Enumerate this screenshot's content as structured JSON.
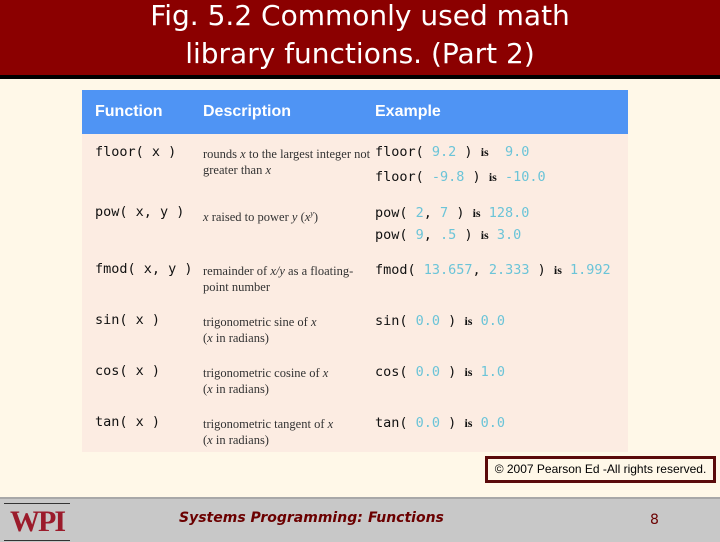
{
  "title": {
    "line1": "Fig. 5.2 Commonly used math",
    "line2": "library functions. (Part 2)"
  },
  "table": {
    "headers": [
      "Function",
      "Description",
      "Example"
    ],
    "rows": [
      {
        "function": "floor( x )",
        "description_parts": [
          "rounds ",
          "x",
          " to the largest  integer not greater than ",
          "x"
        ],
        "examples": [
          {
            "call": "floor(",
            "args": [
              " 9.2"
            ],
            "close": " )",
            "is": "is",
            "result": "  9.0"
          },
          {
            "call": "floor(",
            "args": [
              " -9.8"
            ],
            "close": " )",
            "is": "is",
            "result": " -10.0"
          }
        ]
      },
      {
        "function": "pow( x, y )",
        "description_parts": [
          "x",
          " raised to power ",
          "y",
          " (",
          "x",
          "y",
          ")"
        ],
        "examples": [
          {
            "call": "pow(",
            "args": [
              " 2",
              ", ",
              "7"
            ],
            "close": " )",
            "is": "is",
            "result": " 128.0"
          },
          {
            "call": "pow(",
            "args": [
              " 9",
              ", ",
              ".5"
            ],
            "close": " )",
            "is": "is",
            "result": " 3.0"
          }
        ]
      },
      {
        "function": "fmod( x, y )",
        "description_parts": [
          "remainder of ",
          "x/y",
          " as a floating-point number"
        ],
        "examples": [
          {
            "call": "fmod(",
            "args": [
              " 13.657",
              ", ",
              "2.333"
            ],
            "close": " )",
            "is": "is",
            "result": " 1.992"
          }
        ]
      },
      {
        "function": "sin( x )",
        "description_parts": [
          "trigonometric sine of ",
          "x",
          " (",
          "x",
          " in radians)"
        ],
        "examples": [
          {
            "call": "sin(",
            "args": [
              " 0.0"
            ],
            "close": " )",
            "is": "is",
            "result": " 0.0"
          }
        ]
      },
      {
        "function": "cos( x )",
        "description_parts": [
          "trigonometric cosine of ",
          "x",
          " (",
          "x",
          " in radians)"
        ],
        "examples": [
          {
            "call": "cos(",
            "args": [
              " 0.0"
            ],
            "close": " )",
            "is": "is",
            "result": " 1.0"
          }
        ]
      },
      {
        "function": "tan( x )",
        "description_parts": [
          "trigonometric tangent of ",
          "x",
          " (",
          "x",
          " in radians)"
        ],
        "examples": [
          {
            "call": "tan(",
            "args": [
              " 0.0"
            ],
            "close": " )",
            "is": "is",
            "result": " 0.0"
          }
        ]
      }
    ]
  },
  "copyright": "© 2007 Pearson Ed -All rights reserved.",
  "footer": {
    "logo": "WPI",
    "course": "Systems Programming:",
    "topic": "Functions",
    "page": "8"
  },
  "colors": {
    "title_bg": "#8b0000",
    "header_bg": "#4f94f4",
    "row_bg": "#fcece2",
    "value": "#6bc4d8",
    "page_bg": "#fff8e8",
    "footer_bg": "#c8c8c8",
    "footer_text": "#6b0000"
  }
}
